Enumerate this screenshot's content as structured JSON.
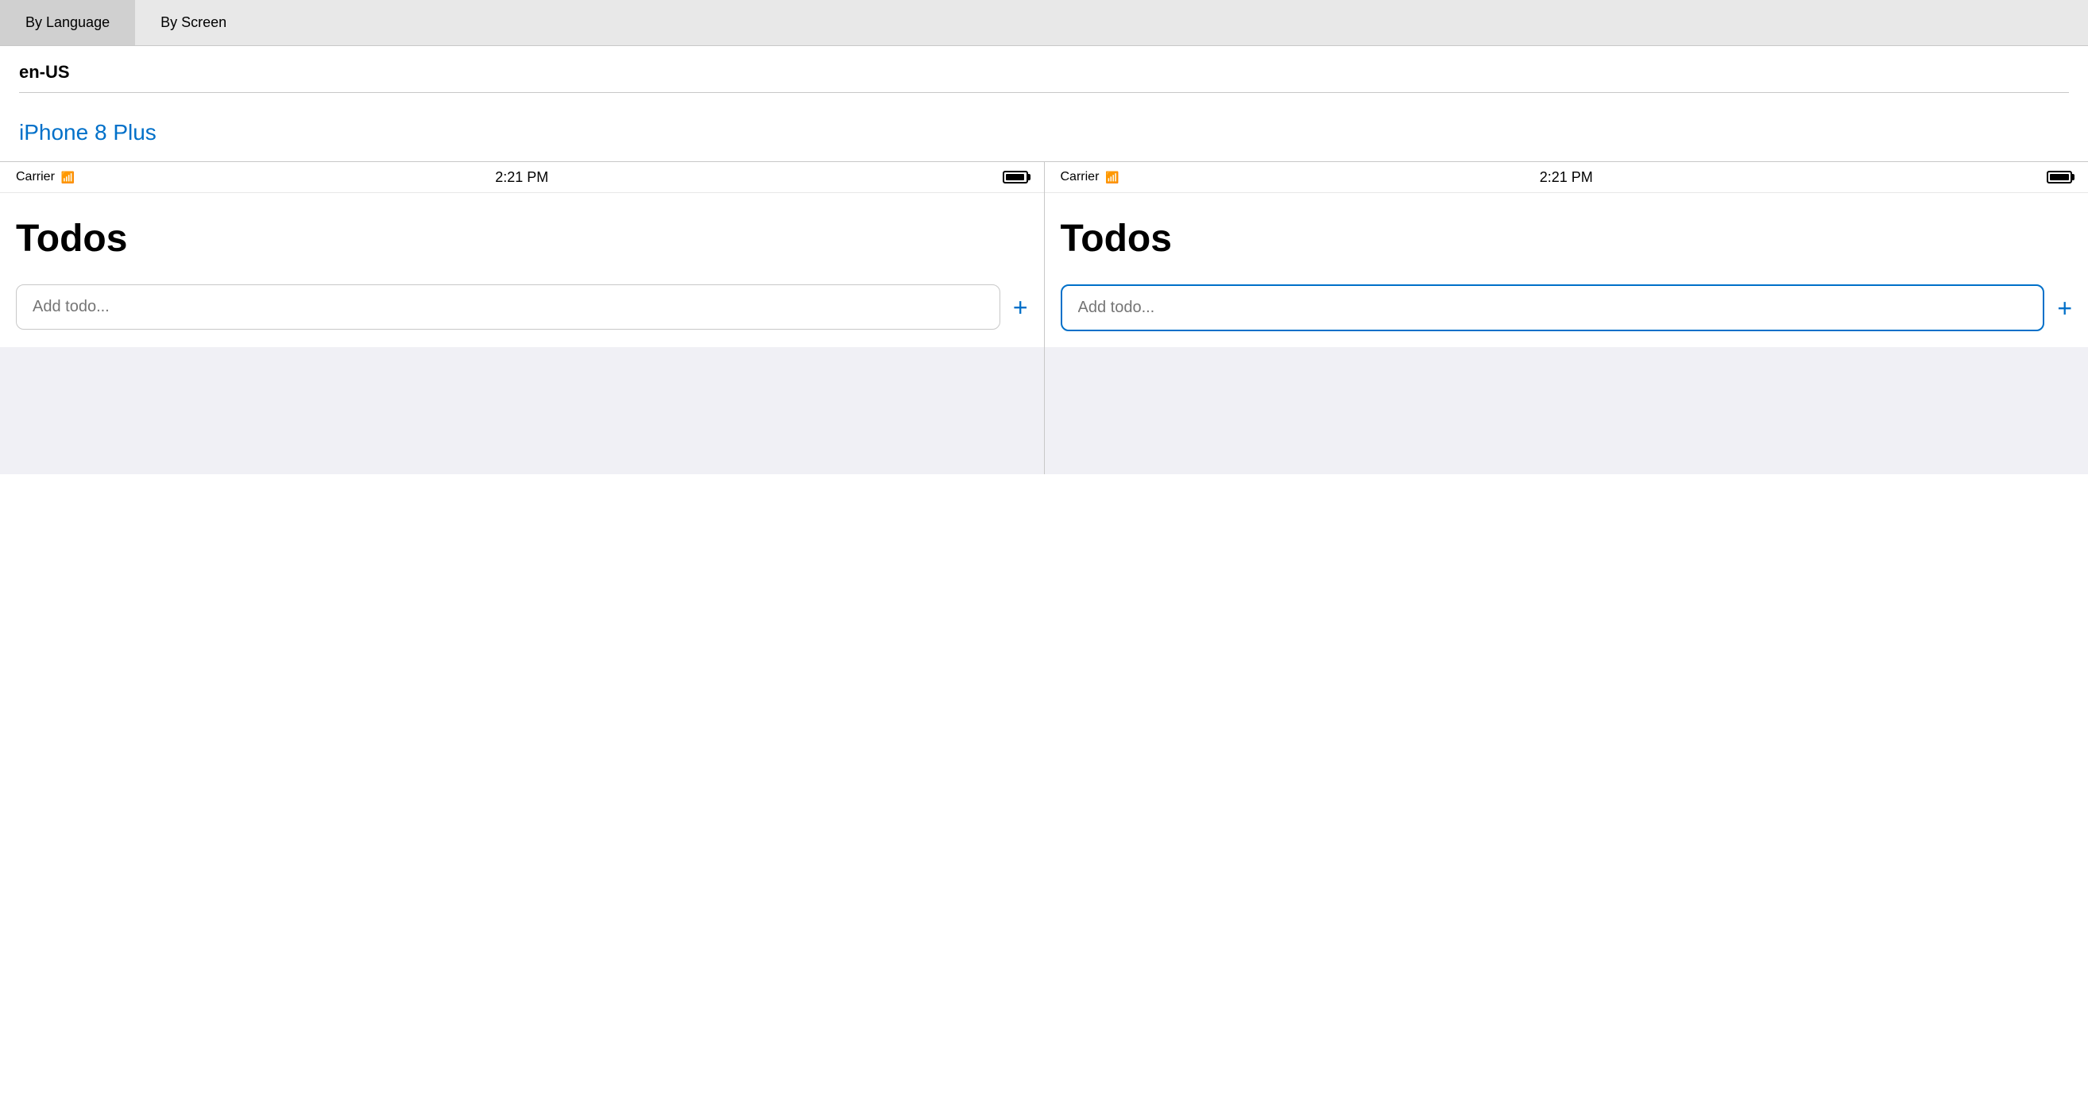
{
  "tabs": [
    {
      "id": "by-language",
      "label": "By Language",
      "active": true
    },
    {
      "id": "by-screen",
      "label": "By Screen",
      "active": false
    }
  ],
  "language": {
    "code": "en-US"
  },
  "device": {
    "name": "iPhone 8 Plus",
    "link": "#"
  },
  "screens": [
    {
      "id": "screen-left",
      "statusBar": {
        "carrier": "Carrier",
        "time": "2:21 PM"
      },
      "appTitle": "Todos",
      "inputPlaceholder": "Add todo...",
      "addButtonLabel": "+",
      "inputFocused": false
    },
    {
      "id": "screen-right",
      "statusBar": {
        "carrier": "Carrier",
        "time": "2:21 PM"
      },
      "appTitle": "Todos",
      "inputPlaceholder": "Add todo...",
      "addButtonLabel": "+",
      "inputFocused": true
    }
  ],
  "icons": {
    "wifi": "📶",
    "battery": "battery",
    "plus": "+"
  }
}
